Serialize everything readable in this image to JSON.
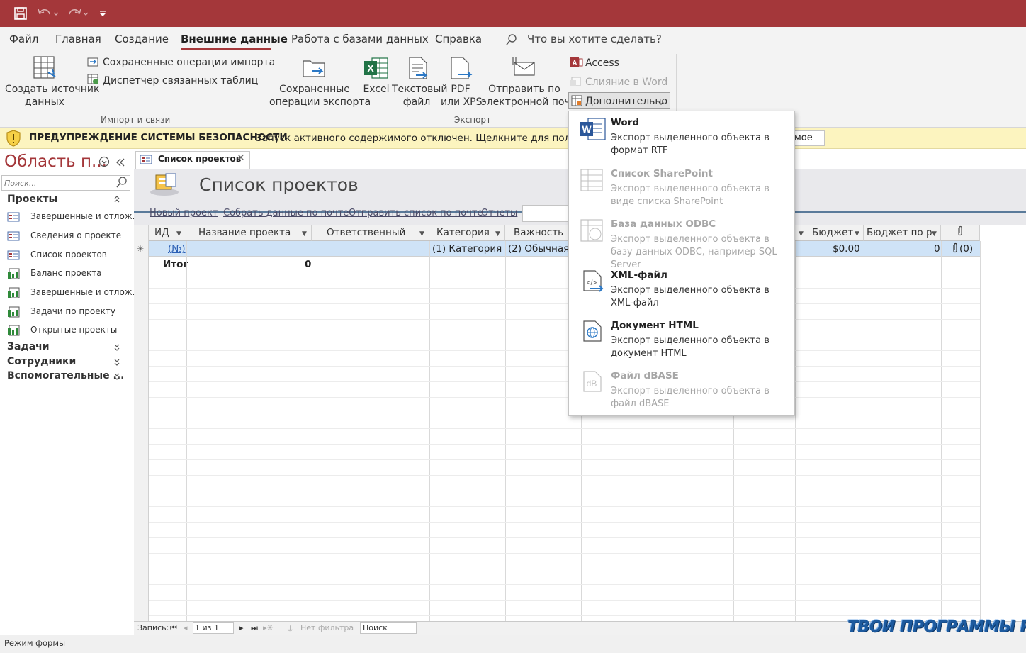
{
  "ribbon": {
    "tabs": [
      "Файл",
      "Главная",
      "Создание",
      "Внешние данные",
      "Работа с базами данных",
      "Справка"
    ],
    "active_tab": "Внешние данные",
    "tell_me": "Что вы хотите сделать?",
    "import": {
      "create_source_line1": "Создать источник",
      "create_source_line2": "данных",
      "saved_imports": "Сохраненные операции импорта",
      "linked_tables": "Диспетчер связанных таблиц",
      "group_label": "Импорт и связи"
    },
    "export": {
      "saved_exports_line1": "Сохраненные",
      "saved_exports_line2": "операции экспорта",
      "excel": "Excel",
      "text_line1": "Текстовый",
      "text_line2": "файл",
      "pdf_line1": "PDF",
      "pdf_line2": "или XPS",
      "email_line1": "Отправить по",
      "email_line2": "электронной почте",
      "access": "Access",
      "merge_word": "Слияние в Word",
      "more": "Дополнительно",
      "group_label": "Экспорт"
    }
  },
  "security_bar": {
    "title": "ПРЕДУПРЕЖДЕНИЕ СИСТЕМЫ БЕЗОПАСНОСТИ",
    "message": "Запуск активного содержимого отключен. Щелкните для получения дополнительных сведений.",
    "button": "мое"
  },
  "nav_pane": {
    "title": "Область п...",
    "search_placeholder": "Поиск...",
    "groups": [
      {
        "label": "Проекты",
        "items": [
          "Завершенные и отлож...",
          "Сведения о проекте",
          "Список проектов",
          "Баланс проекта",
          "Завершенные и отлож...",
          "Задачи по проекту",
          "Открытые проекты"
        ]
      },
      {
        "label": "Задачи"
      },
      {
        "label": "Сотрудники"
      },
      {
        "label": "Вспомогательные ..."
      }
    ]
  },
  "document": {
    "tab_label": "Список проектов",
    "form_title": "Список проектов",
    "links": [
      "Новый проект",
      "Собрать данные по почте",
      "Отправить список по почте",
      "Отчеты"
    ]
  },
  "datasheet": {
    "columns": [
      "ИД",
      "Название проекта",
      "Ответственный",
      "Категория",
      "Важность",
      "Бюджет",
      "Бюджет по р",
      "📎"
    ],
    "new_row": {
      "id": "(№)",
      "category": "(1) Категория",
      "importance": "(2) Обычная",
      "budget": "$0.00",
      "budget_by": "0",
      "attach": "(0)"
    },
    "total_row": {
      "label": "Итог",
      "value": "0"
    }
  },
  "record_nav": {
    "label": "Запись:",
    "position": "1 из 1",
    "filter": "Нет фильтра",
    "search": "Поиск"
  },
  "status": {
    "text": "Режим формы"
  },
  "watermark": "ТВОИ ПРОГРАММЫ РУ",
  "dropdown": {
    "items": [
      {
        "title": "Word",
        "desc": "Экспорт выделенного объекта в формат RTF",
        "enabled": true
      },
      {
        "title": "Список SharePoint",
        "desc": "Экспорт выделенного объекта в виде списка SharePoint",
        "enabled": false
      },
      {
        "title": "База данных ODBC",
        "desc": "Экспорт выделенного объекта в базу данных ODBC, например SQL Server",
        "enabled": false
      },
      {
        "title": "XML-файл",
        "desc": "Экспорт выделенного объекта в XML-файл",
        "enabled": true
      },
      {
        "title": "Документ HTML",
        "desc": "Экспорт выделенного объекта в документ HTML",
        "enabled": true
      },
      {
        "title": "Файл dBASE",
        "desc": "Экспорт выделенного объекта в файл dBASE",
        "enabled": false
      }
    ]
  },
  "colors": {
    "accent": "#a4373a",
    "selected_row": "#cfe3f7",
    "security_bar": "#fcf4bf"
  }
}
